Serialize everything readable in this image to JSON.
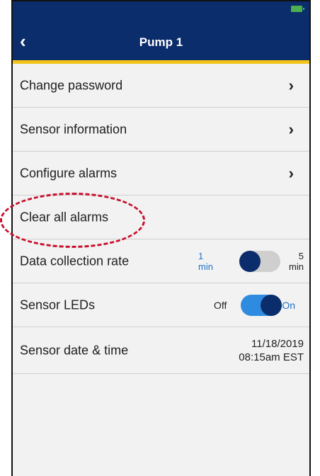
{
  "header": {
    "title": "Pump 1",
    "back_icon": "‹",
    "battery": "charging-battery-icon"
  },
  "menu": {
    "change_password": "Change password",
    "sensor_information": "Sensor information",
    "configure_alarms": "Configure alarms",
    "clear_all_alarms": "Clear all alarms",
    "chevron": "›"
  },
  "data_collection": {
    "label": "Data collection rate",
    "left_value": "1",
    "left_unit": "min",
    "right_value": "5",
    "right_unit": "min",
    "selected": "1 min"
  },
  "sensor_leds": {
    "label": "Sensor LEDs",
    "off_label": "Off",
    "on_label": "On",
    "state": "On"
  },
  "sensor_datetime": {
    "label": "Sensor date & time",
    "date": "11/18/2019",
    "time": "08:15am EST"
  },
  "colors": {
    "header_bg": "#0c2d6b",
    "accent_bar": "#f2c417",
    "toggle_blue": "#2f8be0",
    "highlight_circle": "#c8102e"
  }
}
